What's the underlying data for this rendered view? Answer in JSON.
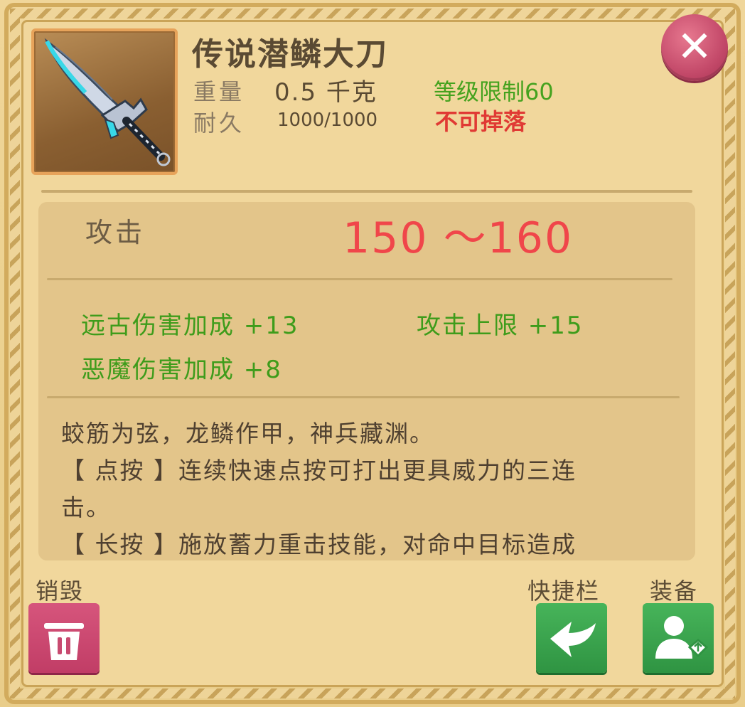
{
  "item": {
    "name": "传说潜鳞大刀",
    "icon": "legendary-broadsword-icon",
    "weight_label": "重量",
    "weight_value": "0.5 千克",
    "durability_label": "耐久",
    "durability_value": "1000/1000",
    "level_requirement": "等级限制60",
    "drop_status": "不可掉落"
  },
  "stats": {
    "attack_label": "攻击",
    "attack_value": "150 ～160",
    "bonuses": [
      "远古伤害加成 +13",
      "攻击上限 +15",
      "恶魔伤害加成 +8"
    ]
  },
  "description": {
    "lines": [
      "蛟筋为弦，龙鳞作甲，神兵藏渊。",
      "【 点按 】连续快速点按可打出更具威力的三连",
      "击。",
      "【 长按 】施放蓄力重击技能，对命中目标造成"
    ]
  },
  "actions": {
    "destroy_label": "销毁",
    "shortcut_label": "快捷栏",
    "equip_label": "装备"
  },
  "colors": {
    "attack_value": "#f0464a",
    "bonus_text": "#3e9c1b",
    "level_requirement": "#45a21e",
    "drop_status": "#e03a34",
    "close_button": "#c44a6a",
    "destroy_button": "#c13d66",
    "action_button": "#2f9442"
  }
}
